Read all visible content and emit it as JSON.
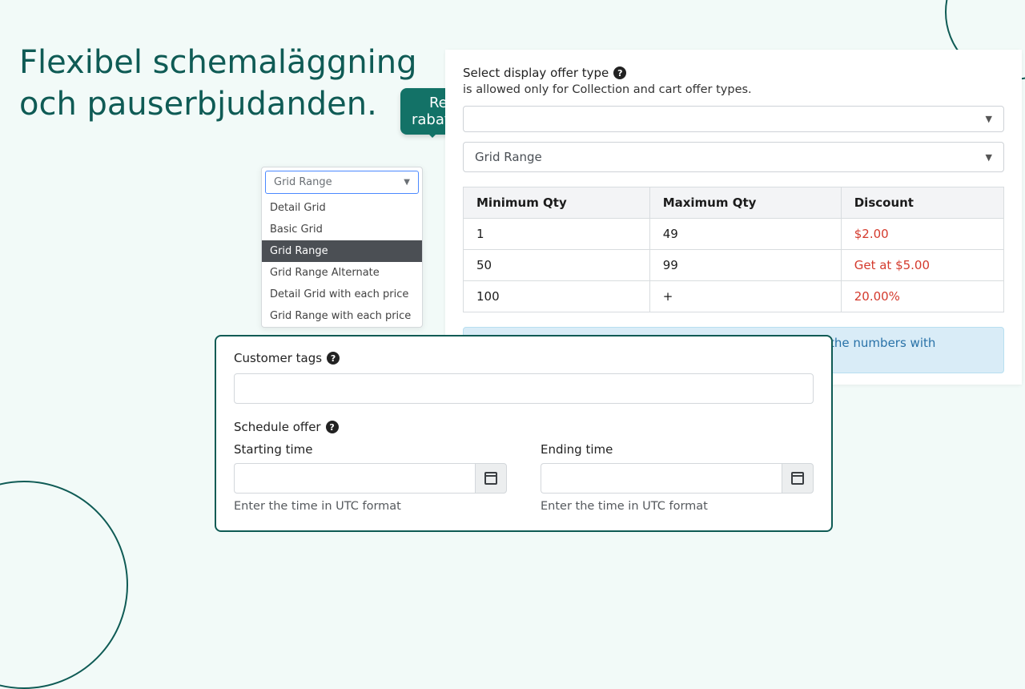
{
  "headline": {
    "line1": "Flexibel schemaläggning",
    "line2": "och pauserbjudanden."
  },
  "speech": {
    "line1": "Redigera",
    "line2": "rabatttabeller"
  },
  "dropdown": {
    "selected": "Grid Range",
    "options": [
      "Detail Grid",
      "Basic Grid",
      "Grid Range",
      "Grid Range Alternate",
      "Detail Grid with each price",
      "Grid Range with each price"
    ]
  },
  "offer_panel": {
    "label": "Select display offer type",
    "note": "is allowed only for Collection and cart offer types.",
    "select2_value": "Grid Range",
    "table": {
      "headers": {
        "min": "Minimum Qty",
        "max": "Maximum Qty",
        "disc": "Discount"
      },
      "rows": [
        {
          "min": "1",
          "max": "49",
          "disc": "$2.00"
        },
        {
          "min": "50",
          "max": "99",
          "disc": "Get at $5.00"
        },
        {
          "min": "100",
          "max": "+",
          "disc": "20.00%"
        }
      ]
    },
    "info": "This app's default number format automatically rounds the numbers with decimals."
  },
  "schedule": {
    "tags_label": "Customer tags",
    "sched_label": "Schedule offer",
    "start_label": "Starting time",
    "end_label": "Ending time",
    "hint": "Enter the time in UTC format"
  }
}
